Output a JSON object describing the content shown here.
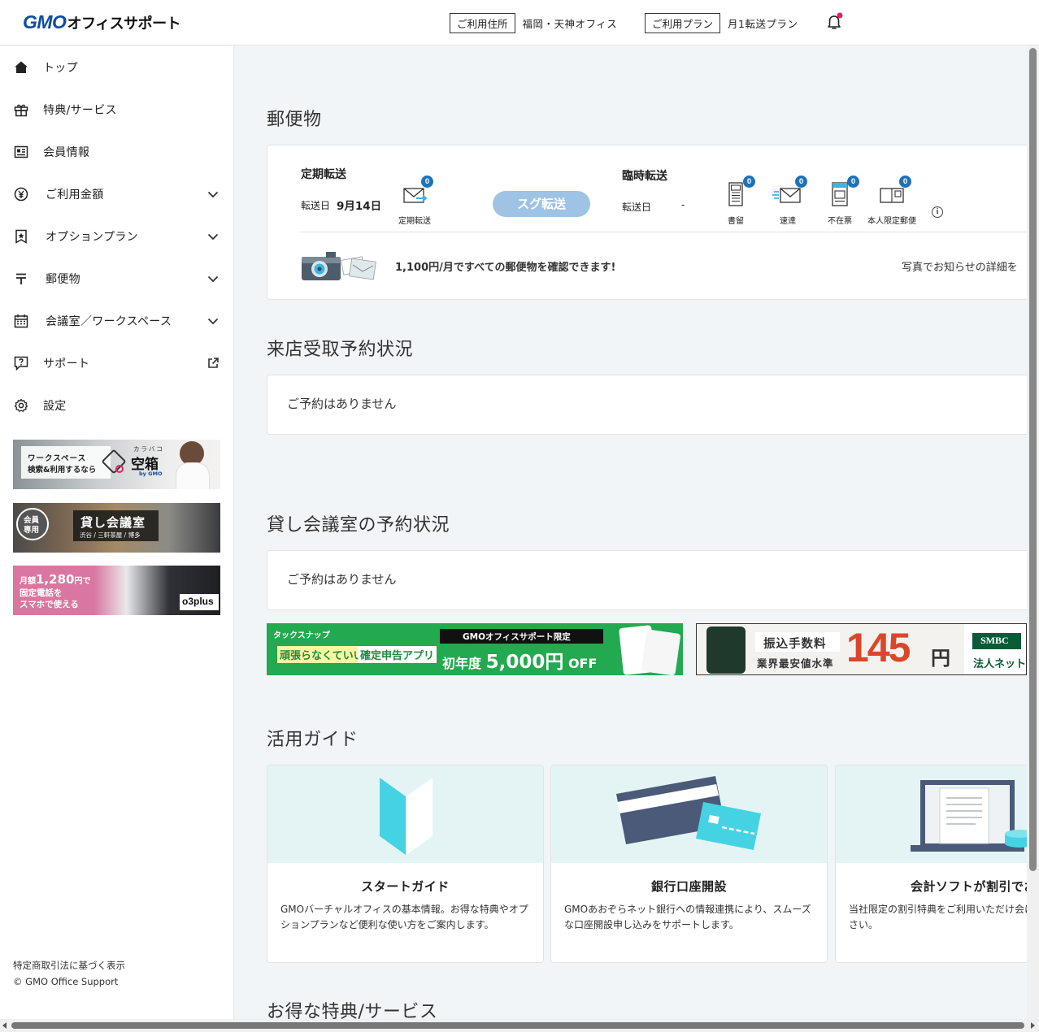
{
  "header": {
    "logo_brand": "GMO",
    "logo_text": "オフィスサポート",
    "address_tag": "ご利用住所",
    "address_value": "福岡・天神オフィス",
    "plan_tag": "ご利用プラン",
    "plan_value": "月1転送プラン"
  },
  "sidebar": {
    "items": [
      {
        "label": "トップ"
      },
      {
        "label": "特典/サービス"
      },
      {
        "label": "会員情報"
      },
      {
        "label": "ご利用金額"
      },
      {
        "label": "オプションプラン"
      },
      {
        "label": "郵便物"
      },
      {
        "label": "会議室／ワークスペース"
      },
      {
        "label": "サポート"
      },
      {
        "label": "設定"
      }
    ],
    "banners": {
      "karabako_line1": "ワークスペース",
      "karabako_line2": "検索&利用するなら",
      "karabako_ruby": "カラバコ",
      "karabako_name": "空箱",
      "karabako_by": "by GMO",
      "kaigi_badge1": "会員",
      "kaigi_badge2": "専用",
      "kaigi_title": "貸し会議室",
      "kaigi_sub": "渋谷 / 三軒茶屋 / 博多",
      "o3_line1_a": "月額",
      "o3_price": "1,280",
      "o3_line1_b": "円で",
      "o3_line2": "固定電話を",
      "o3_line3": "スマホで使える",
      "o3_logo": "o3plus"
    },
    "footer": {
      "law_link": "特定商取引法に基づく表示",
      "copyright": "© GMO Office Support"
    }
  },
  "mail": {
    "section_title": "郵便物",
    "regular_title": "定期転送",
    "regular_date_label": "転送日",
    "regular_date_value": "9月14日",
    "regular_icon_label": "定期転送",
    "regular_count": "0",
    "sugu_button": "スグ転送",
    "temp_title": "臨時転送",
    "temp_date_label": "転送日",
    "temp_date_value": "-",
    "icons": [
      {
        "label": "書留",
        "count": "0"
      },
      {
        "label": "速達",
        "count": "0"
      },
      {
        "label": "不在票",
        "count": "0"
      },
      {
        "label": "本人限定郵便",
        "count": "0"
      }
    ],
    "promo_text": "1,100円/月ですべての郵便物を確認できます!",
    "promo_link": "写真でお知らせの詳細を"
  },
  "store_pickup": {
    "section_title": "来店受取予約状況",
    "empty": "ご予約はありません"
  },
  "meeting_room": {
    "section_title": "貸し会議室の予約状況",
    "empty": "ご予約はありません"
  },
  "ads": {
    "tax_brand": "タックスナップ",
    "tax_tagline_a": "頑張らなくていい",
    "tax_tagline_b": "確定申告アプリ",
    "tax_limited": "GMOオフィスサポート限定",
    "tax_offer_a": "初年度",
    "tax_offer_b": "5,000円",
    "tax_offer_c": "OFF",
    "bank_line1": "振込手数料",
    "bank_line2": "業界最安値水準",
    "bank_price": "145",
    "bank_unit": "円",
    "bank_brand": "SMBC",
    "bank_sub": "法人ネット"
  },
  "guide": {
    "section_title": "活用ガイド",
    "cards": [
      {
        "title": "スタートガイド",
        "desc": "GMOバーチャルオフィスの基本情報。お得な特典やオプションプランなど便利な使い方をご案内します。"
      },
      {
        "title": "銀行口座開設",
        "desc": "GMOあおぞらネット銀行への情報連携により、スムーズな口座開設申し込みをサポートします。"
      },
      {
        "title": "会計ソフトが割引でお",
        "desc": "当社限定の割引特典をご利用いただけ会にぜひご検討ください。"
      }
    ]
  },
  "benefits": {
    "section_title": "お得な特典/サービス"
  },
  "colors": {
    "brand_blue": "#0b4ea2",
    "badge_blue": "#1d72b8",
    "sugu_button": "#9fc3e4",
    "background": "#f2f5f7",
    "notification_dot": "#e0245e"
  }
}
